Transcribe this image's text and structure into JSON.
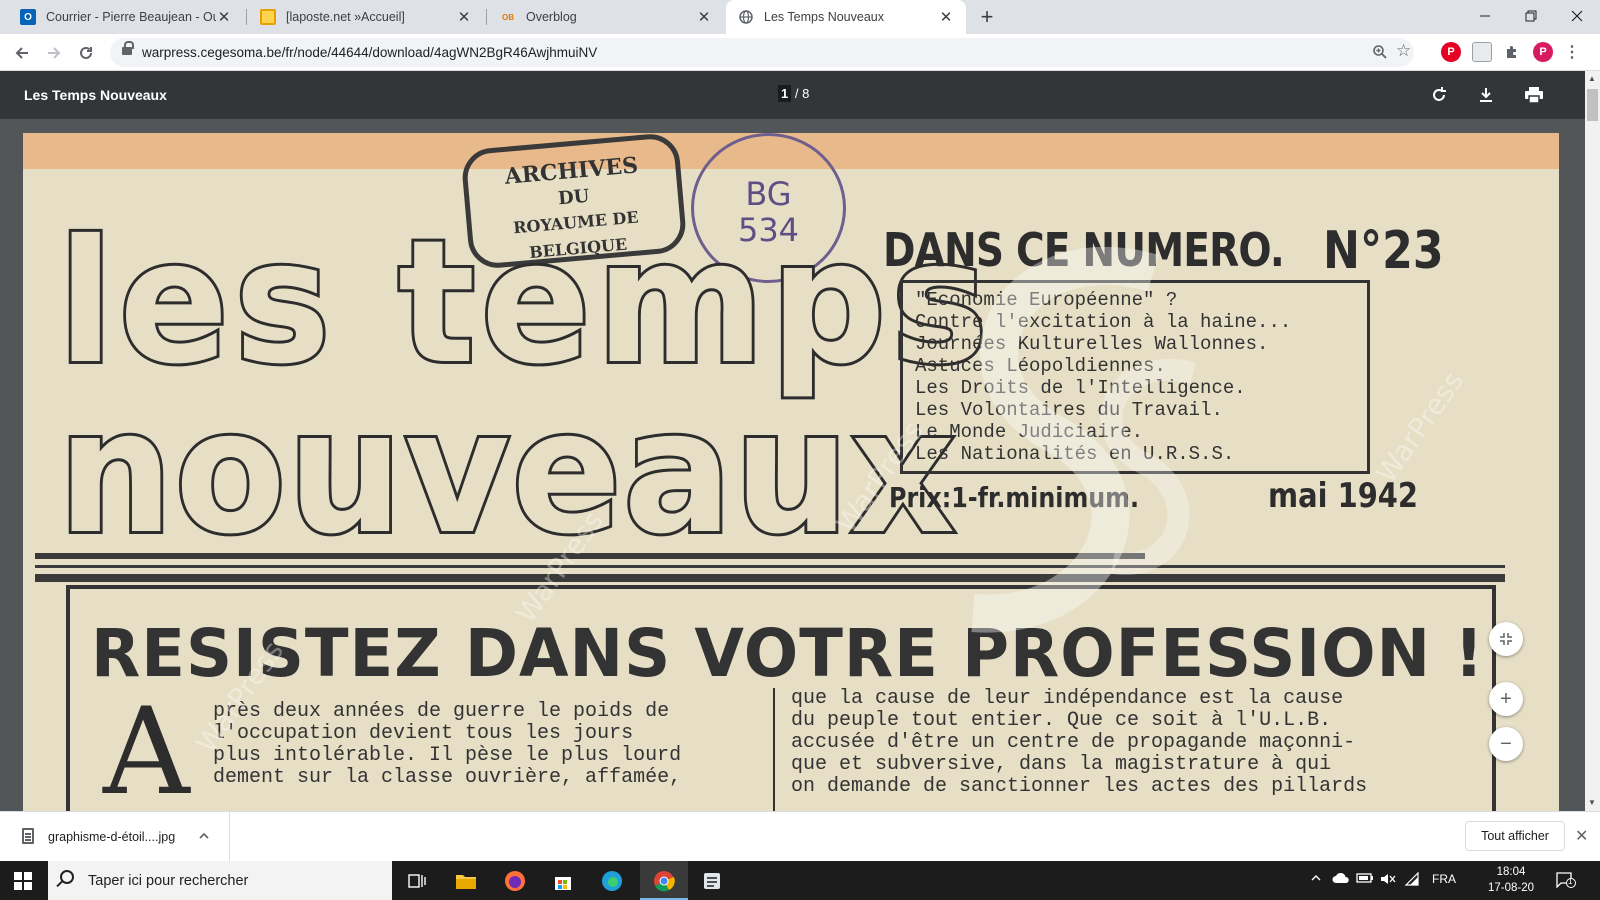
{
  "browser": {
    "tabs": [
      {
        "title": "Courrier - Pierre Beaujean - Outlo",
        "icon": "outlook-icon",
        "close": "✕"
      },
      {
        "title": "[laposte.net »Accueil]",
        "icon": "mail-icon",
        "close": "✕"
      },
      {
        "title": "Overblog",
        "icon": "overblog-icon",
        "favtext": "OB",
        "close": "✕"
      },
      {
        "title": "Les Temps Nouveaux",
        "icon": "globe-icon",
        "close": "✕"
      }
    ],
    "new_tab": "+",
    "url": "warpress.cegesoma.be/fr/node/44644/download/4agWN2BgR46AwjhmuiNV",
    "profile_initial": "P",
    "pinterest_initial": "P"
  },
  "pdf": {
    "title": "Les Temps Nouveaux",
    "current_page": "1",
    "total_pages": "/ 8"
  },
  "document": {
    "stamp_lines": [
      "ARCHIVES",
      "DU",
      "ROYAUME DE BELGIQUE"
    ],
    "round_stamp": [
      "BG",
      "534"
    ],
    "masthead_line1": "les temps",
    "masthead_line2": "nouveaux",
    "dans_ce_numero": "DANS CE NUMERO.",
    "issue": "N°23",
    "contents": [
      "\"Economie Européenne\" ?",
      "Contre l'excitation à la haine...",
      "Journées Kulturelles Wallonnes.",
      "Astuces Léopoldiennes.",
      "Les Droits de l'Intelligence.",
      "Les Volontaires du Travail.",
      "Le Monde Judiciaire.",
      "Les Nationalités en U.R.S.S."
    ],
    "price": "Prix:1-fr.minimum.",
    "date": "mai 1942",
    "headline": "RESISTEZ DANS VOTRE PROFESSION !",
    "dropcap": "A",
    "col1": [
      "près deux années de guerre le poids de",
      "l'occupation devient tous les jours",
      "plus intolérable. Il pèse le plus lourd",
      "dement sur la classe ouvrière, affamée,"
    ],
    "col2": [
      "que la cause de leur indépendance est la cause",
      "du peuple tout entier. Que ce soit à l'U.L.B.",
      "accusée d'être un centre de propagande maçonni-",
      "que et subversive, dans la magistrature à qui",
      "on demande de sanctionner les actes des pillards"
    ],
    "watermark": "WarPress"
  },
  "downloads": {
    "file": "graphisme-d-étoil....jpg",
    "show_all": "Tout afficher"
  },
  "taskbar": {
    "search_placeholder": "Taper ici pour rechercher",
    "lang": "FRA",
    "time": "18:04",
    "date": "17-08-20",
    "notif_count": "1"
  },
  "colors": {
    "tabstrip": "#dee1e6",
    "pdf_toolbar": "#323639",
    "paper": "#e6dfc6",
    "ink": "#2d2d2d",
    "stamp_purple": "#5d4f86"
  }
}
